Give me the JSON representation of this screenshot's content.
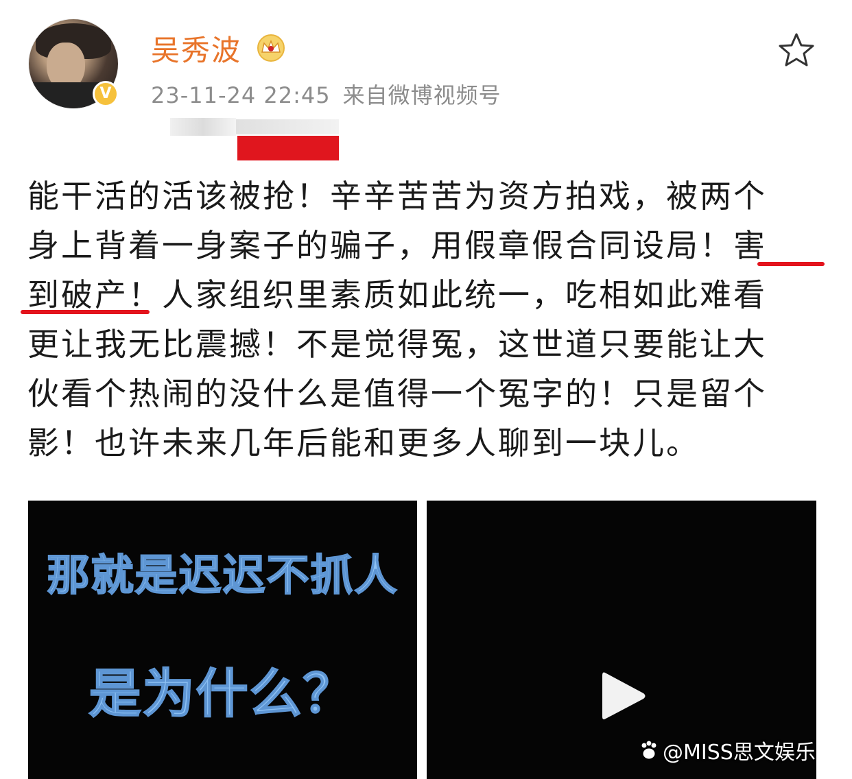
{
  "post": {
    "author": "吴秀波",
    "time": "23-11-24 22:45",
    "source": "来自微博视频号",
    "verified_icon": "verified-v-badge-icon",
    "member_icon": "crown-icon",
    "favorite_icon": "star-icon",
    "text_lines": [
      "能干活的活该被抢！辛辛苦苦为资方拍戏，被两个",
      "身上背着一身案子的骗子，用假章假合同设局！害",
      "到破产！人家组织里素质如此统一，吃相如此难看",
      "更让我无比震撼！不是觉得冤，这世道只要能让大",
      "伙看个热闹的没什么是值得一个冤字的！只是留个",
      "影！也许未来几年后能和更多人聊到一块儿。"
    ]
  },
  "media": {
    "video_left": {
      "caption_line1": "那就是迟迟不抓人",
      "caption_line2": "是为什么？",
      "caption_color": "#8cc0f3"
    },
    "video_right": {
      "play_icon": "play-icon"
    }
  },
  "watermark": {
    "text": "@MISS思文娱乐",
    "icon": "paw-icon"
  },
  "colors": {
    "username": "#e8742a",
    "meta": "#8c8c8c",
    "highlight_underline": "#e3141d",
    "redaction": "#e0161e"
  }
}
